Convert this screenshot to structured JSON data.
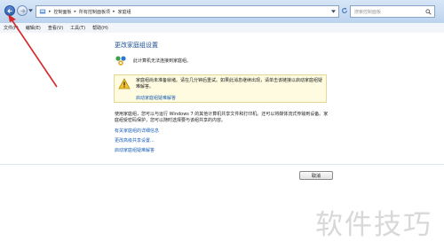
{
  "window": {
    "address_crumbs": [
      "控制面板",
      "所有控制面板项",
      "家庭组"
    ],
    "search_placeholder": "搜索控制面板"
  },
  "menu": {
    "items": [
      "文件(F)",
      "编辑(E)",
      "查看(V)",
      "工具(T)",
      "帮助(H)"
    ]
  },
  "main": {
    "title": "更改家庭组设置",
    "status_text": "此计算机无法连接到家庭组。",
    "warning_text": "家庭组尚未准备就绪。请在几分钟后重试。如果此消息继续出现，请单击该链接以启动家庭组疑难解答。",
    "warning_link": "启动家庭组疑难解答",
    "description": "使用家庭组，您可以与运行 Windows 7 的其他计算机共享文件和打印机。还可以将媒体流式传输到设备。家庭组受密码保护，您可以随时选择要与该组共享的内容。",
    "links": [
      "有关家庭组的详细信息",
      "更改高级共享设置...",
      "启动家庭组疑难解答"
    ]
  },
  "footer": {
    "cancel_label": "取消"
  },
  "watermark": "软件技巧",
  "colors": {
    "link": "#1b5fb8",
    "title": "#1e4e93",
    "annotation_arrow": "#d62828",
    "warning_bg": "#fefbe0"
  },
  "icons": [
    "back-arrow-icon",
    "forward-arrow-icon",
    "homegroup-icon",
    "warning-icon",
    "search-icon",
    "refresh-icon"
  ]
}
